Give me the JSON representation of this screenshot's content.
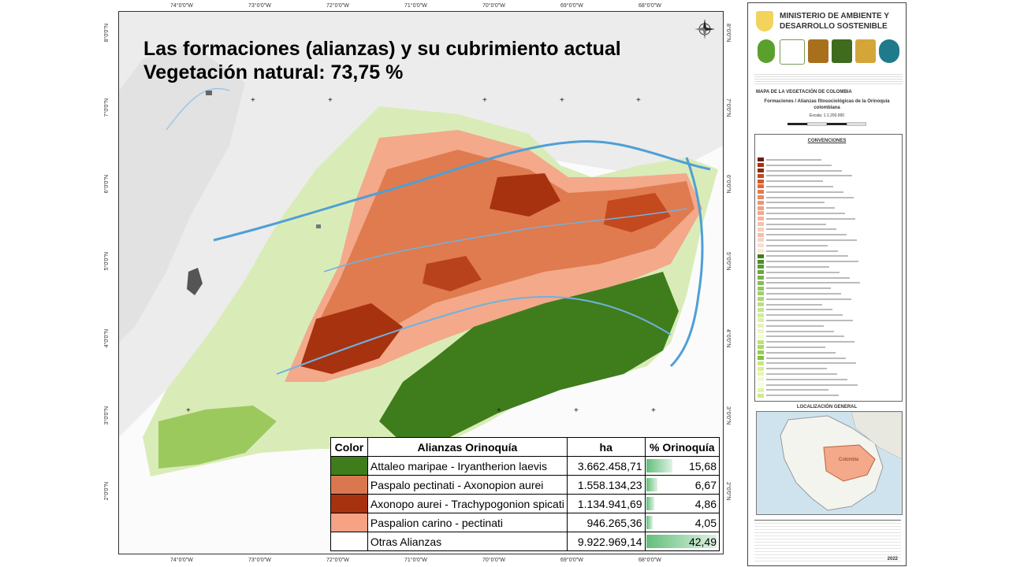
{
  "title": {
    "line1": "Las formaciones (alianzas) y su cubrimiento actual",
    "line2": "Vegetación natural: 73,75 %"
  },
  "map": {
    "top_coords": [
      "74°0'0\"W",
      "73°0'0\"W",
      "72°0'0\"W",
      "71°0'0\"W",
      "70°0'0\"W",
      "69°0'0\"W",
      "68°0'0\"W"
    ],
    "bottom_coords": [
      "74°0'0\"W",
      "73°0'0\"W",
      "72°0'0\"W",
      "71°0'0\"W",
      "70°0'0\"W",
      "69°0'0\"W",
      "68°0'0\"W"
    ],
    "left_coords": [
      "8°0'0\"N",
      "7°0'0\"N",
      "6°0'0\"N",
      "5°0'0\"N",
      "4°0'0\"N",
      "3°0'0\"N",
      "2°0'0\"N"
    ],
    "right_coords": [
      "8°0'0\"N",
      "7°0'0\"N",
      "6°0'0\"N",
      "5°0'0\"N",
      "4°0'0\"N",
      "3°0'0\"N",
      "2°0'0\"N"
    ],
    "region_colors": {
      "attaleo": "#3f7d1c",
      "paspalo": "#e07b4f",
      "axonopo": "#a7320f",
      "paspalion": "#f3a98a",
      "otras": "#d9ecb8",
      "river": "#4f9fd6",
      "andes": "#e6e6e6"
    }
  },
  "legend_table": {
    "headers": {
      "color": "Color",
      "alianza": "Alianzas Orinoquía",
      "ha": "ha",
      "pct": "% Orinoquía"
    },
    "rows": [
      {
        "color": "#3f7d1c",
        "name": "Attaleo maripae - Iryantherion laevis",
        "ha": "3.662.458,71",
        "pct": "15,68",
        "pct_value": 15.68
      },
      {
        "color": "#d9784f",
        "name": "Paspalo pectinati - Axonopion aurei",
        "ha": "1.558.134,23",
        "pct": "6,67",
        "pct_value": 6.67
      },
      {
        "color": "#a7320f",
        "name": "Axonopo aurei - Trachypogonion spicati",
        "ha": "1.134.941,69",
        "pct": "4,86",
        "pct_value": 4.86
      },
      {
        "color": "#f6a284",
        "name": "Paspalion carino - pectinati",
        "ha": "946.265,36",
        "pct": "4,05",
        "pct_value": 4.05
      },
      {
        "color": "#ffffff",
        "name": "Otras Alianzas",
        "ha": "9.922.969,14",
        "pct": "42,49",
        "pct_value": 42.49
      }
    ]
  },
  "panel": {
    "ministry": "MINISTERIO DE AMBIENTE Y DESARROLLO SOSTENIBLE",
    "map_title": "MAPA DE LA VEGETACIÓN DE COLOMBIA",
    "map_subtitle": "Formaciones / Alianzas fitosociológicas de la Orinoquía colombiana",
    "scale": "Escala: 1:1.200.000",
    "conventions": "CONVENCIONES",
    "location": "LOCALIZACIÓN GENERAL",
    "location_label": "Colombia",
    "year": "2022",
    "legend_colors": [
      "#6b1d0c",
      "#a7320f",
      "#8a2a12",
      "#c4491e",
      "#d45a2a",
      "#e06a3a",
      "#e57b4f",
      "#e88a62",
      "#eb9573",
      "#f0a083",
      "#f3a98a",
      "#f6b59a",
      "#f5c1ab",
      "#f8ccb9",
      "#f3bfa8",
      "#f6d3c6",
      "#f9ddd2",
      "#fbe6de",
      "#3f7d1c",
      "#4f8d28",
      "#5c9a33",
      "#6aa83e",
      "#78b34a",
      "#86bd55",
      "#93c660",
      "#a1cf6c",
      "#aed778",
      "#bbde84",
      "#c7e590",
      "#d2eb9c",
      "#dcf0a8",
      "#e5f4b4",
      "#edf8c0",
      "#f3fbcc",
      "#bfe07a",
      "#a9d964",
      "#93ce50",
      "#7dc33e",
      "#c8e87c",
      "#d8ef96",
      "#e6f5b2",
      "#f0f9cc",
      "#f6fcde",
      "#e3f3a6",
      "#cfe98a"
    ]
  }
}
